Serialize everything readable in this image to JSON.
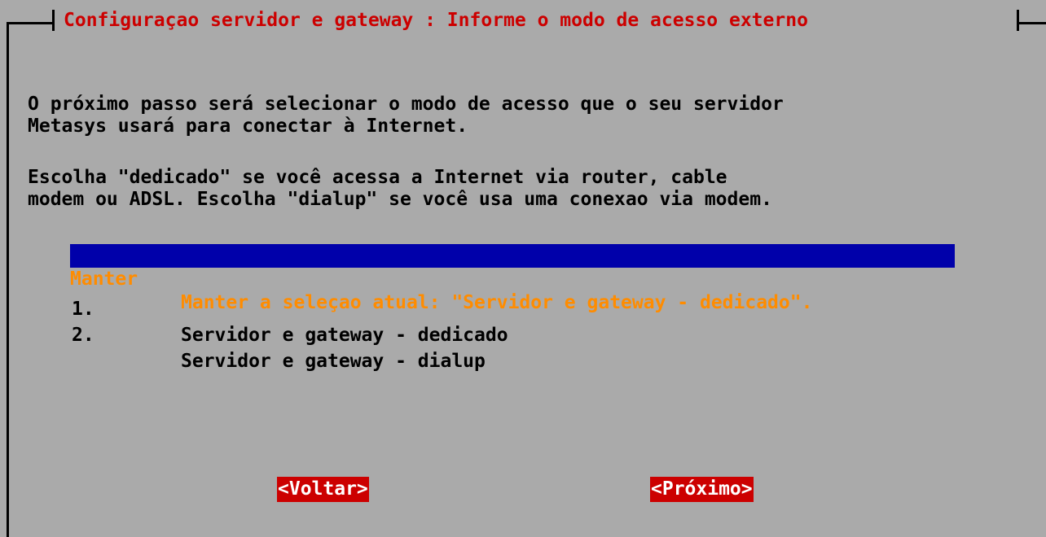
{
  "dialog": {
    "title": "Configuraçao servidor e gateway : Informe o modo de acesso externo",
    "text_lines": [
      "O próximo passo será selecionar o modo de acesso que o seu servidor",
      "Metasys usará para conectar à Internet.",
      "Escolha \"dedicado\" se você acessa a Internet via router, cable",
      "modem ou ADSL. Escolha \"dialup\" se você usa uma conexao via modem."
    ],
    "menu": [
      {
        "tag": "Manter",
        "desc": "Manter a seleçao atual: \"Servidor e gateway - dedicado\".",
        "selected": true
      },
      {
        "tag": "1.",
        "desc": "Servidor e gateway - dedicado",
        "selected": false
      },
      {
        "tag": "2.",
        "desc": "Servidor e gateway - dialup",
        "selected": false
      }
    ],
    "buttons": {
      "back_label": "<Voltar>",
      "next_label": "<Próximo>"
    }
  },
  "colors": {
    "background": "#aaaaaa",
    "title": "#cc0000",
    "selection_bg": "#0000aa",
    "selection_fg": "#ff8c00",
    "button_bg": "#cc0000",
    "button_fg": "#ffffff"
  }
}
